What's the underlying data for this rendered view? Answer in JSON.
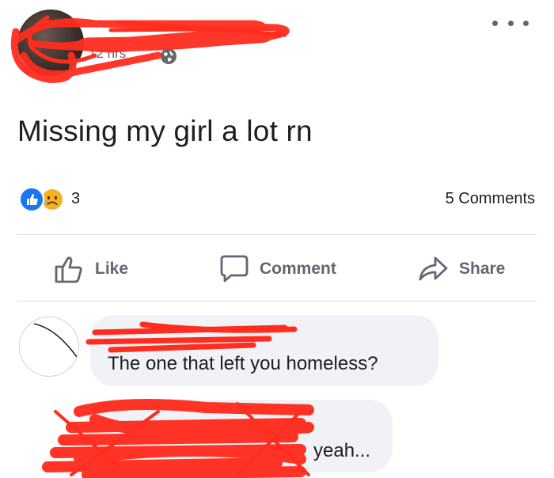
{
  "post": {
    "timestamp": "12 hrs",
    "text": "Missing my girl a lot rn"
  },
  "reactions": {
    "count": "3",
    "types": [
      "like-icon",
      "sad-icon"
    ],
    "comments_label": "5 Comments"
  },
  "actions": {
    "like_label": "Like",
    "comment_label": "Comment",
    "share_label": "Share"
  },
  "comments": [
    {
      "text": "The one that left you homeless?"
    },
    {
      "text": "yeah..."
    }
  ],
  "colors": {
    "like_blue": "#1877f2",
    "action_gray": "#606770",
    "bubble_bg": "#f0f2f5",
    "redaction_red": "#ff2d1f"
  }
}
